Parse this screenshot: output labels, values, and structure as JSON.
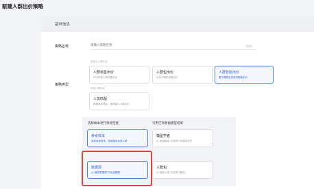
{
  "page": {
    "title": "新建人群出价策略"
  },
  "section": {
    "title": "基础信息"
  },
  "strategy_name": {
    "label": "策略名称",
    "placeholder": "请输入策略名称",
    "counter": "0/20"
  },
  "strategy_type": {
    "label": "策略类型",
    "group1_label": "自定义人群出价",
    "group2_label": "优选人群出价",
    "cards": [
      {
        "title": "人群标签出价",
        "desc": "可对标签人群设置出价"
      },
      {
        "title": "人群包出价",
        "desc": "可对人群包设置出价"
      },
      {
        "title": "人群智能出价",
        "desc": "基于模型生成定向智能出价"
      },
      {
        "title": "人货匹配",
        "desc": "根据商品特征，推荐潜力人群出价"
      }
    ]
  },
  "generation": {
    "left_header": "选择样本进行系统拓展",
    "right_header": "引用已有数据模型结果",
    "options": [
      {
        "title": "参考样本",
        "desc": "选择参考样本，拓展相似优质人群"
      },
      {
        "title": "模型学者",
        "desc": "从\"数据模型\"中选择已有模型任务"
      },
      {
        "title": "数据源",
        "desc": "从\"我的数据源\"中勾选数据"
      },
      {
        "title": "人群包",
        "desc": "从\"我的人群\"中选择人群包"
      }
    ]
  },
  "colors": {
    "accent": "#4a7df0",
    "highlight": "#e0453b"
  }
}
